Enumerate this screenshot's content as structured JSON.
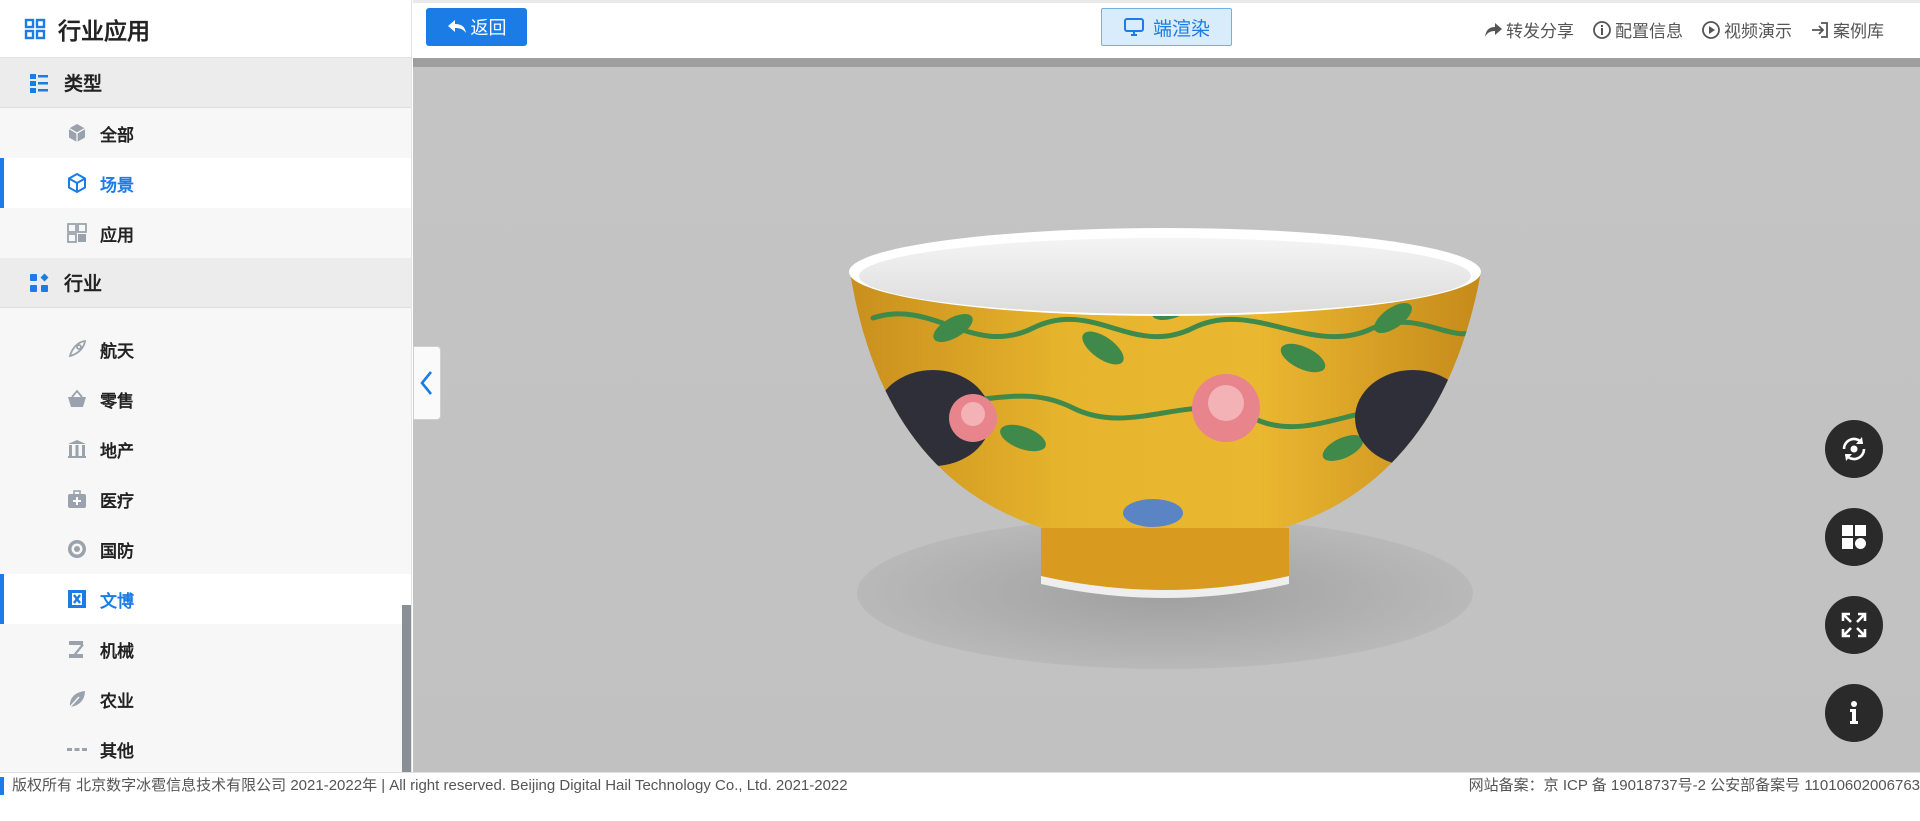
{
  "sidebar": {
    "title": "行业应用",
    "sections": [
      {
        "label": "类型",
        "items": [
          {
            "label": "全部",
            "active": false
          },
          {
            "label": "场景",
            "active": true
          },
          {
            "label": "应用",
            "active": false
          }
        ]
      },
      {
        "label": "行业",
        "items": [
          {
            "label": "航天",
            "active": false
          },
          {
            "label": "零售",
            "active": false
          },
          {
            "label": "地产",
            "active": false
          },
          {
            "label": "医疗",
            "active": false
          },
          {
            "label": "国防",
            "active": false
          },
          {
            "label": "文博",
            "active": true
          },
          {
            "label": "机械",
            "active": false
          },
          {
            "label": "农业",
            "active": false
          },
          {
            "label": "其他",
            "active": false
          }
        ]
      }
    ]
  },
  "toolbar": {
    "back_label": "返回",
    "render_label": "端渲染",
    "links": {
      "share": "转发分享",
      "config": "配置信息",
      "video": "视频演示",
      "cases": "案例库"
    }
  },
  "footer": {
    "copyright": "版权所有 北京数字冰雹信息技术有限公司 2021-2022年 | All right reserved. Beijing Digital Hail Technology Co., Ltd. 2021-2022",
    "icp": "网站备案：京 ICP 备 19018737号-2 公安部备案号 11010602006763"
  },
  "colors": {
    "accent": "#1a7ce4",
    "sidebar_bg": "#f7f7f7",
    "viewer_bg": "#c3c3c3",
    "fab_bg": "#2a2a2a"
  }
}
